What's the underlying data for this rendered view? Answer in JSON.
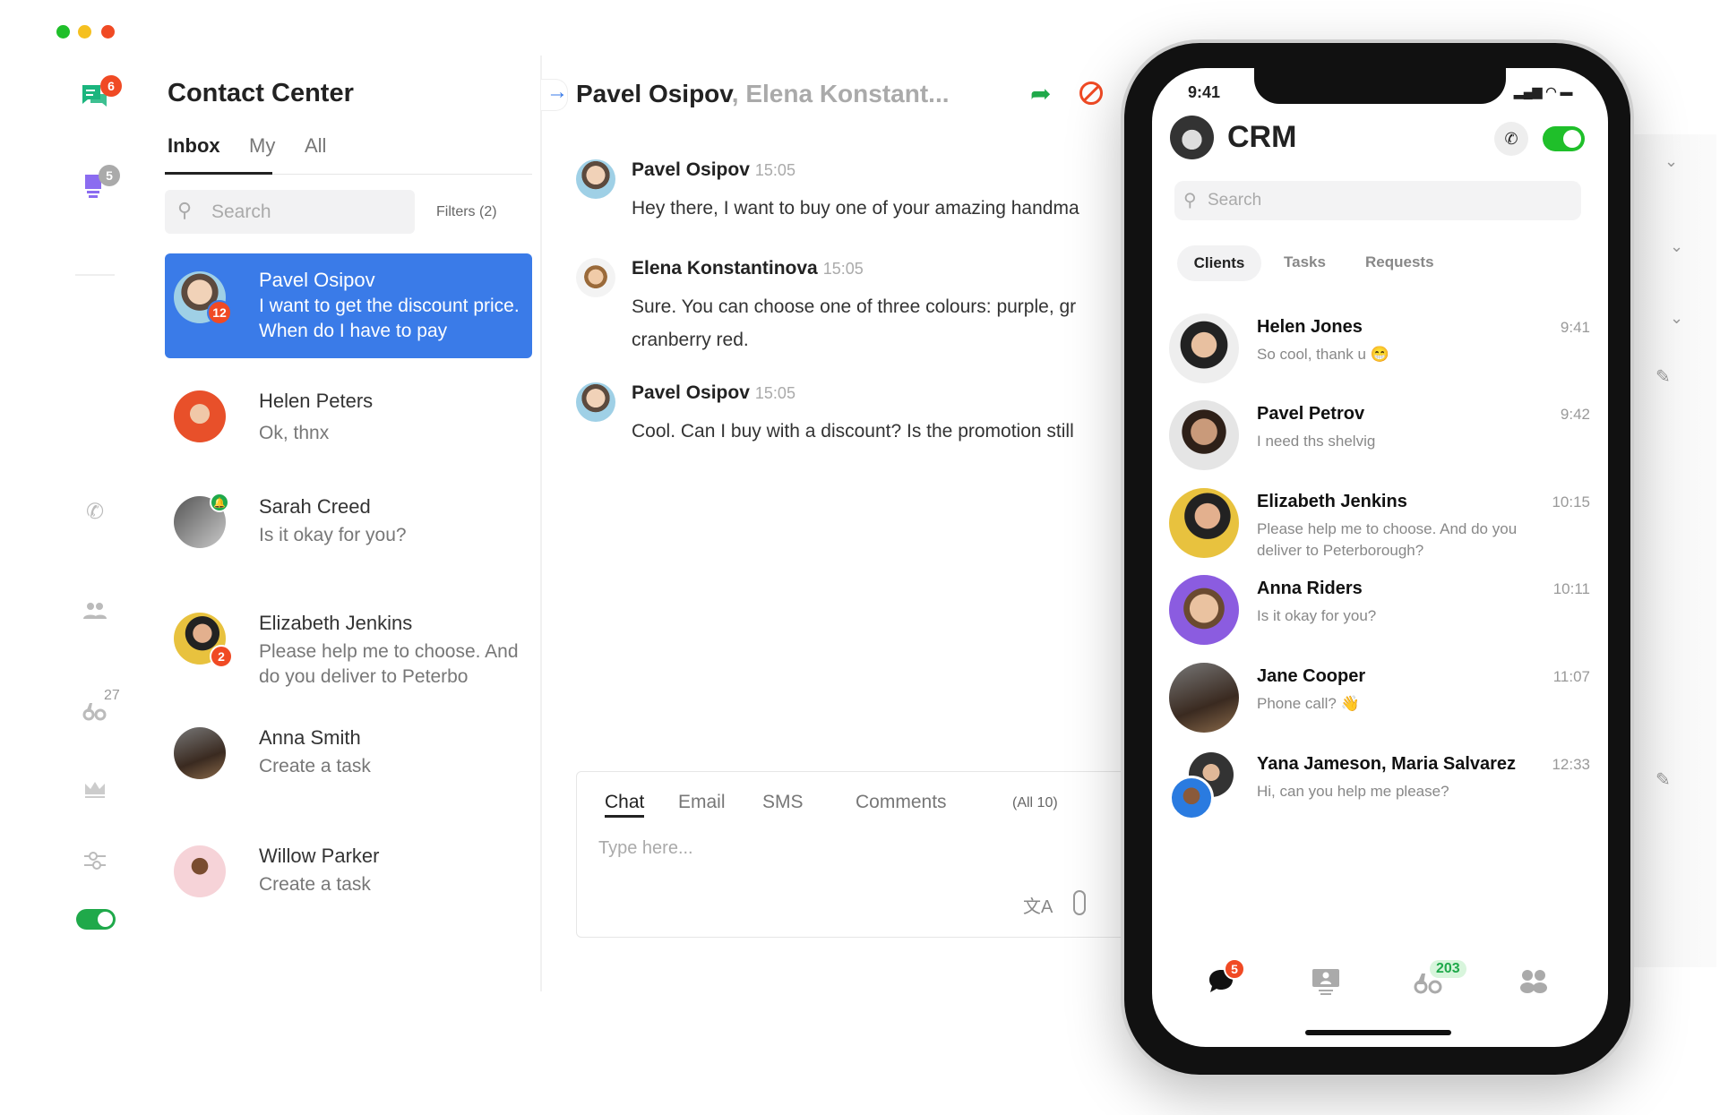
{
  "window": {
    "controls": [
      "close",
      "minimize",
      "maximize"
    ],
    "colors": {
      "green": "#1fbf2a",
      "yellow": "#f5c020",
      "red": "#f04a24"
    }
  },
  "sidebar": {
    "items": [
      {
        "name": "chats",
        "icon": "chat-icon",
        "badge": "6",
        "color": "#1bb57e"
      },
      {
        "name": "ideas",
        "icon": "lightbulb-icon",
        "badge": "5",
        "color": "#8b6cf0"
      },
      {
        "name": "calls",
        "icon": "phone-icon"
      },
      {
        "name": "contacts",
        "icon": "users-icon"
      },
      {
        "name": "monitor",
        "icon": "binoculars-icon",
        "badge": "27"
      },
      {
        "name": "premium",
        "icon": "crown-icon"
      },
      {
        "name": "settings",
        "icon": "sliders-icon"
      }
    ],
    "status_toggle": {
      "on": true,
      "color": "#1fa94a"
    }
  },
  "contact_center": {
    "title": "Contact Center",
    "tabs": [
      "Inbox",
      "My",
      "All"
    ],
    "active_tab": "Inbox",
    "search_placeholder": "Search",
    "filters_label": "Filters (2)",
    "conversations": [
      {
        "name": "Pavel Osipov",
        "message": "I want to get the discount price. When do I have to pay",
        "badge": "12",
        "selected": true
      },
      {
        "name": "Helen Peters",
        "message": "Ok, thnx"
      },
      {
        "name": "Sarah Creed",
        "message": "Is it okay for you?",
        "status": "notification"
      },
      {
        "name": "Elizabeth Jenkins",
        "message": "Please help me to choose. And do you deliver to Peterbo",
        "badge": "2"
      },
      {
        "name": "Anna Smith",
        "message": "Create a task"
      },
      {
        "name": "Willow Parker",
        "message": "Create a task"
      }
    ]
  },
  "chat": {
    "header_primary": "Pavel Osipov",
    "header_secondary": ", Elena Konstant...",
    "messages": [
      {
        "author": "Pavel Osipov",
        "time": "15:05",
        "lines": [
          "Hey there, I want to buy one of your amazing handma"
        ]
      },
      {
        "author": "Elena Konstantinova",
        "time": "15:05",
        "lines": [
          "Sure. You can choose one of three colours: purple, gr",
          "cranberry red."
        ]
      },
      {
        "author": "Pavel Osipov",
        "time": "15:05",
        "lines": [
          "Cool. Can I buy with a discount? Is the promotion still"
        ]
      }
    ],
    "composer": {
      "tabs": [
        "Chat",
        "Email",
        "SMS",
        "Comments"
      ],
      "active_tab": "Chat",
      "all_label": "(All 10)",
      "placeholder": "Type here..."
    }
  },
  "phone": {
    "status_time": "9:41",
    "title": "CRM",
    "toggle_on": true,
    "search_placeholder": "Search",
    "tabs": [
      "Clients",
      "Tasks",
      "Requests"
    ],
    "active_tab": "Clients",
    "clients": [
      {
        "name": "Helen Jones",
        "time": "9:41",
        "message": "So cool, thank u 😁"
      },
      {
        "name": "Pavel Petrov",
        "time": "9:42",
        "message": "I need ths shelvig"
      },
      {
        "name": "Elizabeth Jenkins",
        "time": "10:15",
        "message": "Please help me to choose. And do you deliver to Peterborough?"
      },
      {
        "name": "Anna Riders",
        "time": "10:11",
        "message": "Is it okay for you?"
      },
      {
        "name": "Jane Cooper",
        "time": "11:07",
        "message": "Phone call? 👋"
      },
      {
        "name": "Yana Jameson, Maria Salvarez",
        "time": "12:33",
        "message": "Hi, can you help me please?"
      }
    ],
    "nav": [
      {
        "icon": "chat-icon",
        "badge": "5"
      },
      {
        "icon": "contact-card-icon"
      },
      {
        "icon": "binoculars-icon",
        "badge": "203"
      },
      {
        "icon": "users-icon"
      }
    ]
  }
}
